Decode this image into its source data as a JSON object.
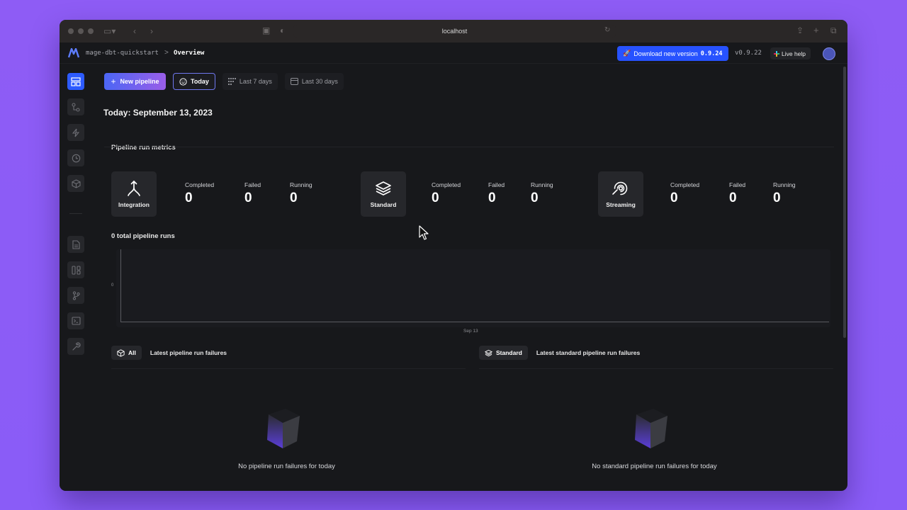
{
  "browser": {
    "url": "localhost"
  },
  "header": {
    "project": "mage-dbt-quickstart",
    "separator": ">",
    "page": "Overview",
    "download_label": "Download new version",
    "download_version": "0.9.24",
    "current_version": "v0.9.22",
    "live_help_label": "Live help"
  },
  "toolbar": {
    "new_pipeline_label": "New pipeline",
    "tabs": [
      {
        "label": "Today",
        "icon": "smile-icon",
        "selected": true
      },
      {
        "label": "Last 7 days",
        "icon": "calendar-week-icon",
        "selected": false
      },
      {
        "label": "Last 30 days",
        "icon": "calendar-icon",
        "selected": false
      }
    ]
  },
  "page_title": "Today: September 13, 2023",
  "metrics": {
    "title": "Pipeline run metrics",
    "groups": [
      {
        "type": "Integration",
        "icon": "integration-icon",
        "completed_label": "Completed",
        "completed": "0",
        "failed_label": "Failed",
        "failed": "0",
        "running_label": "Running",
        "running": "0"
      },
      {
        "type": "Standard",
        "icon": "layers-icon",
        "completed_label": "Completed",
        "completed": "0",
        "failed_label": "Failed",
        "failed": "0",
        "running_label": "Running",
        "running": "0"
      },
      {
        "type": "Streaming",
        "icon": "streaming-icon",
        "completed_label": "Completed",
        "completed": "0",
        "failed_label": "Failed",
        "failed": "0",
        "running_label": "Running",
        "running": "0"
      }
    ]
  },
  "runs_chart": {
    "title": "0 total pipeline runs",
    "y_tick": "0",
    "x_tick": "Sep 13"
  },
  "chart_data": {
    "type": "bar",
    "title": "0 total pipeline runs",
    "categories": [
      "Sep 13"
    ],
    "values": [
      0
    ],
    "xlabel": "",
    "ylabel": "",
    "ylim": [
      0,
      0
    ]
  },
  "failures": {
    "all": {
      "pill_label": "All",
      "title": "Latest pipeline run failures",
      "empty_text": "No pipeline run failures for today"
    },
    "standard": {
      "pill_label": "Standard",
      "title": "Latest standard pipeline run failures",
      "empty_text": "No standard pipeline run failures for today"
    }
  },
  "sidebar": {
    "items": [
      {
        "icon": "dashboard-icon",
        "active": true
      },
      {
        "icon": "pipelines-icon",
        "active": false
      },
      {
        "icon": "triggers-icon",
        "active": false
      },
      {
        "icon": "runs-history-icon",
        "active": false
      },
      {
        "icon": "blocks-cube-icon",
        "active": false
      },
      {
        "icon": "files-icon",
        "active": false
      },
      {
        "icon": "templates-icon",
        "active": false
      },
      {
        "icon": "version-control-icon",
        "active": false
      },
      {
        "icon": "terminal-icon",
        "active": false
      },
      {
        "icon": "settings-wrench-icon",
        "active": false
      }
    ]
  },
  "colors": {
    "accent": "#2d5bff",
    "background": "#17181b",
    "desktop": "#8b5cf6"
  }
}
